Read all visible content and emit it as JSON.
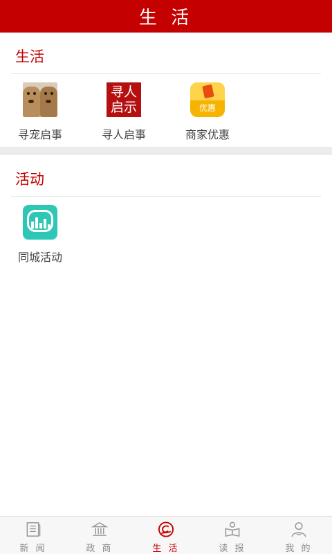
{
  "header": {
    "title": "生 活"
  },
  "sections": [
    {
      "title": "生活",
      "items": [
        {
          "label": "寻宠启事",
          "icon": "pet-dogs-icon"
        },
        {
          "label": "寻人启事",
          "icon": "missing-person-notice-icon",
          "icon_text": [
            "寻人",
            "启示"
          ]
        },
        {
          "label": "商家优惠",
          "icon": "coupon-deal-icon",
          "icon_text": "优惠"
        }
      ]
    },
    {
      "title": "活动",
      "items": [
        {
          "label": "同城活动",
          "icon": "city-activity-icon"
        }
      ]
    }
  ],
  "tabbar": {
    "tabs": [
      {
        "label": "新 闻",
        "icon": "newspaper-icon",
        "active": false
      },
      {
        "label": "政 商",
        "icon": "government-building-icon",
        "active": false
      },
      {
        "label": "生 活",
        "icon": "life-swirl-icon",
        "active": true
      },
      {
        "label": "读 报",
        "icon": "reader-icon",
        "active": false
      },
      {
        "label": "我 的",
        "icon": "user-profile-icon",
        "active": false
      }
    ]
  },
  "colors": {
    "brand": "#c40000",
    "tab_inactive": "#888888",
    "band": "#ececec"
  }
}
